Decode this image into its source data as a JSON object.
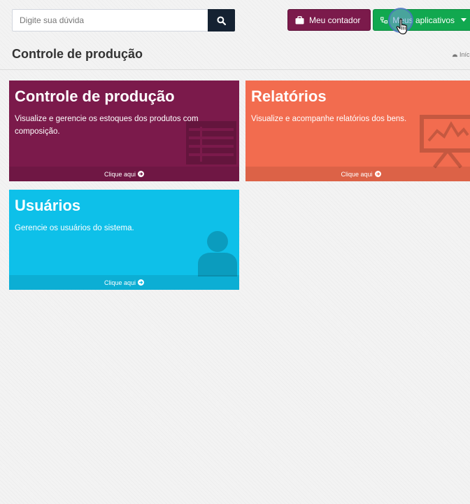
{
  "search": {
    "placeholder": "Digite sua dúvida",
    "icon": "search-icon"
  },
  "header_buttons": {
    "contador_label": "Meu contador",
    "apps_label": "Meus aplicativos"
  },
  "page": {
    "title": "Controle de produção",
    "breadcrumb": "Iníc"
  },
  "tiles": [
    {
      "title": "Controle de produção",
      "description": "Visualize e gerencie os estoques dos produtos com composição.",
      "link": "Clique aqui",
      "color": "#7b1a4b",
      "icon": "table-icon"
    },
    {
      "title": "Relatórios",
      "description": "Visualize e acompanhe relatórios dos bens.",
      "link": "Clique aqui",
      "color": "#f26c4f",
      "icon": "presentation-chart-icon"
    },
    {
      "title": "Usuários",
      "description": "Gerencie os usuários do sistema.",
      "link": "Clique aqui",
      "color": "#0ec0e9",
      "icon": "user-icon"
    }
  ]
}
